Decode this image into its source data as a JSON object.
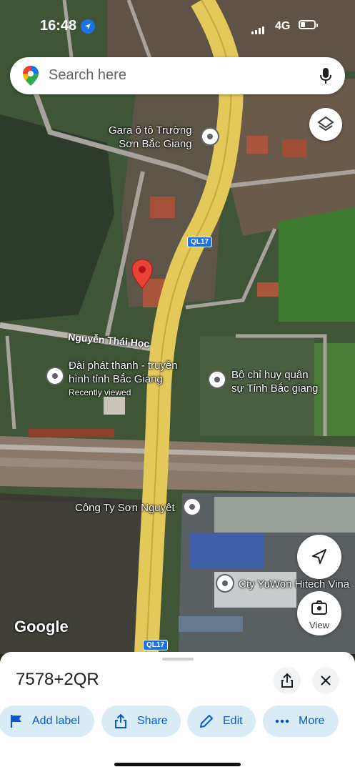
{
  "status_bar": {
    "time": "16:48",
    "network": "4G"
  },
  "search": {
    "placeholder": "Search here"
  },
  "map": {
    "places": [
      {
        "name": "gara-label",
        "lines": [
          "Gara ô tô Trường",
          "Sơn Bắc Giang"
        ]
      },
      {
        "name": "radio-station-label",
        "lines": [
          "Đài phát thanh - truyền",
          "hình tỉnh Bắc Giang"
        ],
        "sub": "Recently viewed"
      },
      {
        "name": "military-command-label",
        "lines": [
          "Bộ chỉ huy quân",
          "sự Tỉnh Bắc giang"
        ]
      },
      {
        "name": "son-nguyet-label",
        "lines": [
          "Công Ty Sơn Nguyệt"
        ]
      },
      {
        "name": "yuwon-label",
        "lines": [
          "Cty YuWon Hitech Vina"
        ]
      }
    ],
    "street": "Nguyễn Thái Học",
    "route_shield": "QL17",
    "attribution": "Google"
  },
  "controls": {
    "view_label": "View"
  },
  "sheet": {
    "plus_code": "7578+2QR",
    "chips": [
      {
        "label": "Add label",
        "icon": "flag-icon"
      },
      {
        "label": "Share",
        "icon": "share-icon"
      },
      {
        "label": "Edit",
        "icon": "pencil-icon"
      },
      {
        "label": "More",
        "icon": "more-dots-icon"
      }
    ]
  },
  "colors": {
    "accent": "#1a73e8",
    "pin": "#ea4335",
    "chip_bg": "#d9ecf6",
    "chip_text": "#0b57d0",
    "road": "#e3c85a"
  }
}
